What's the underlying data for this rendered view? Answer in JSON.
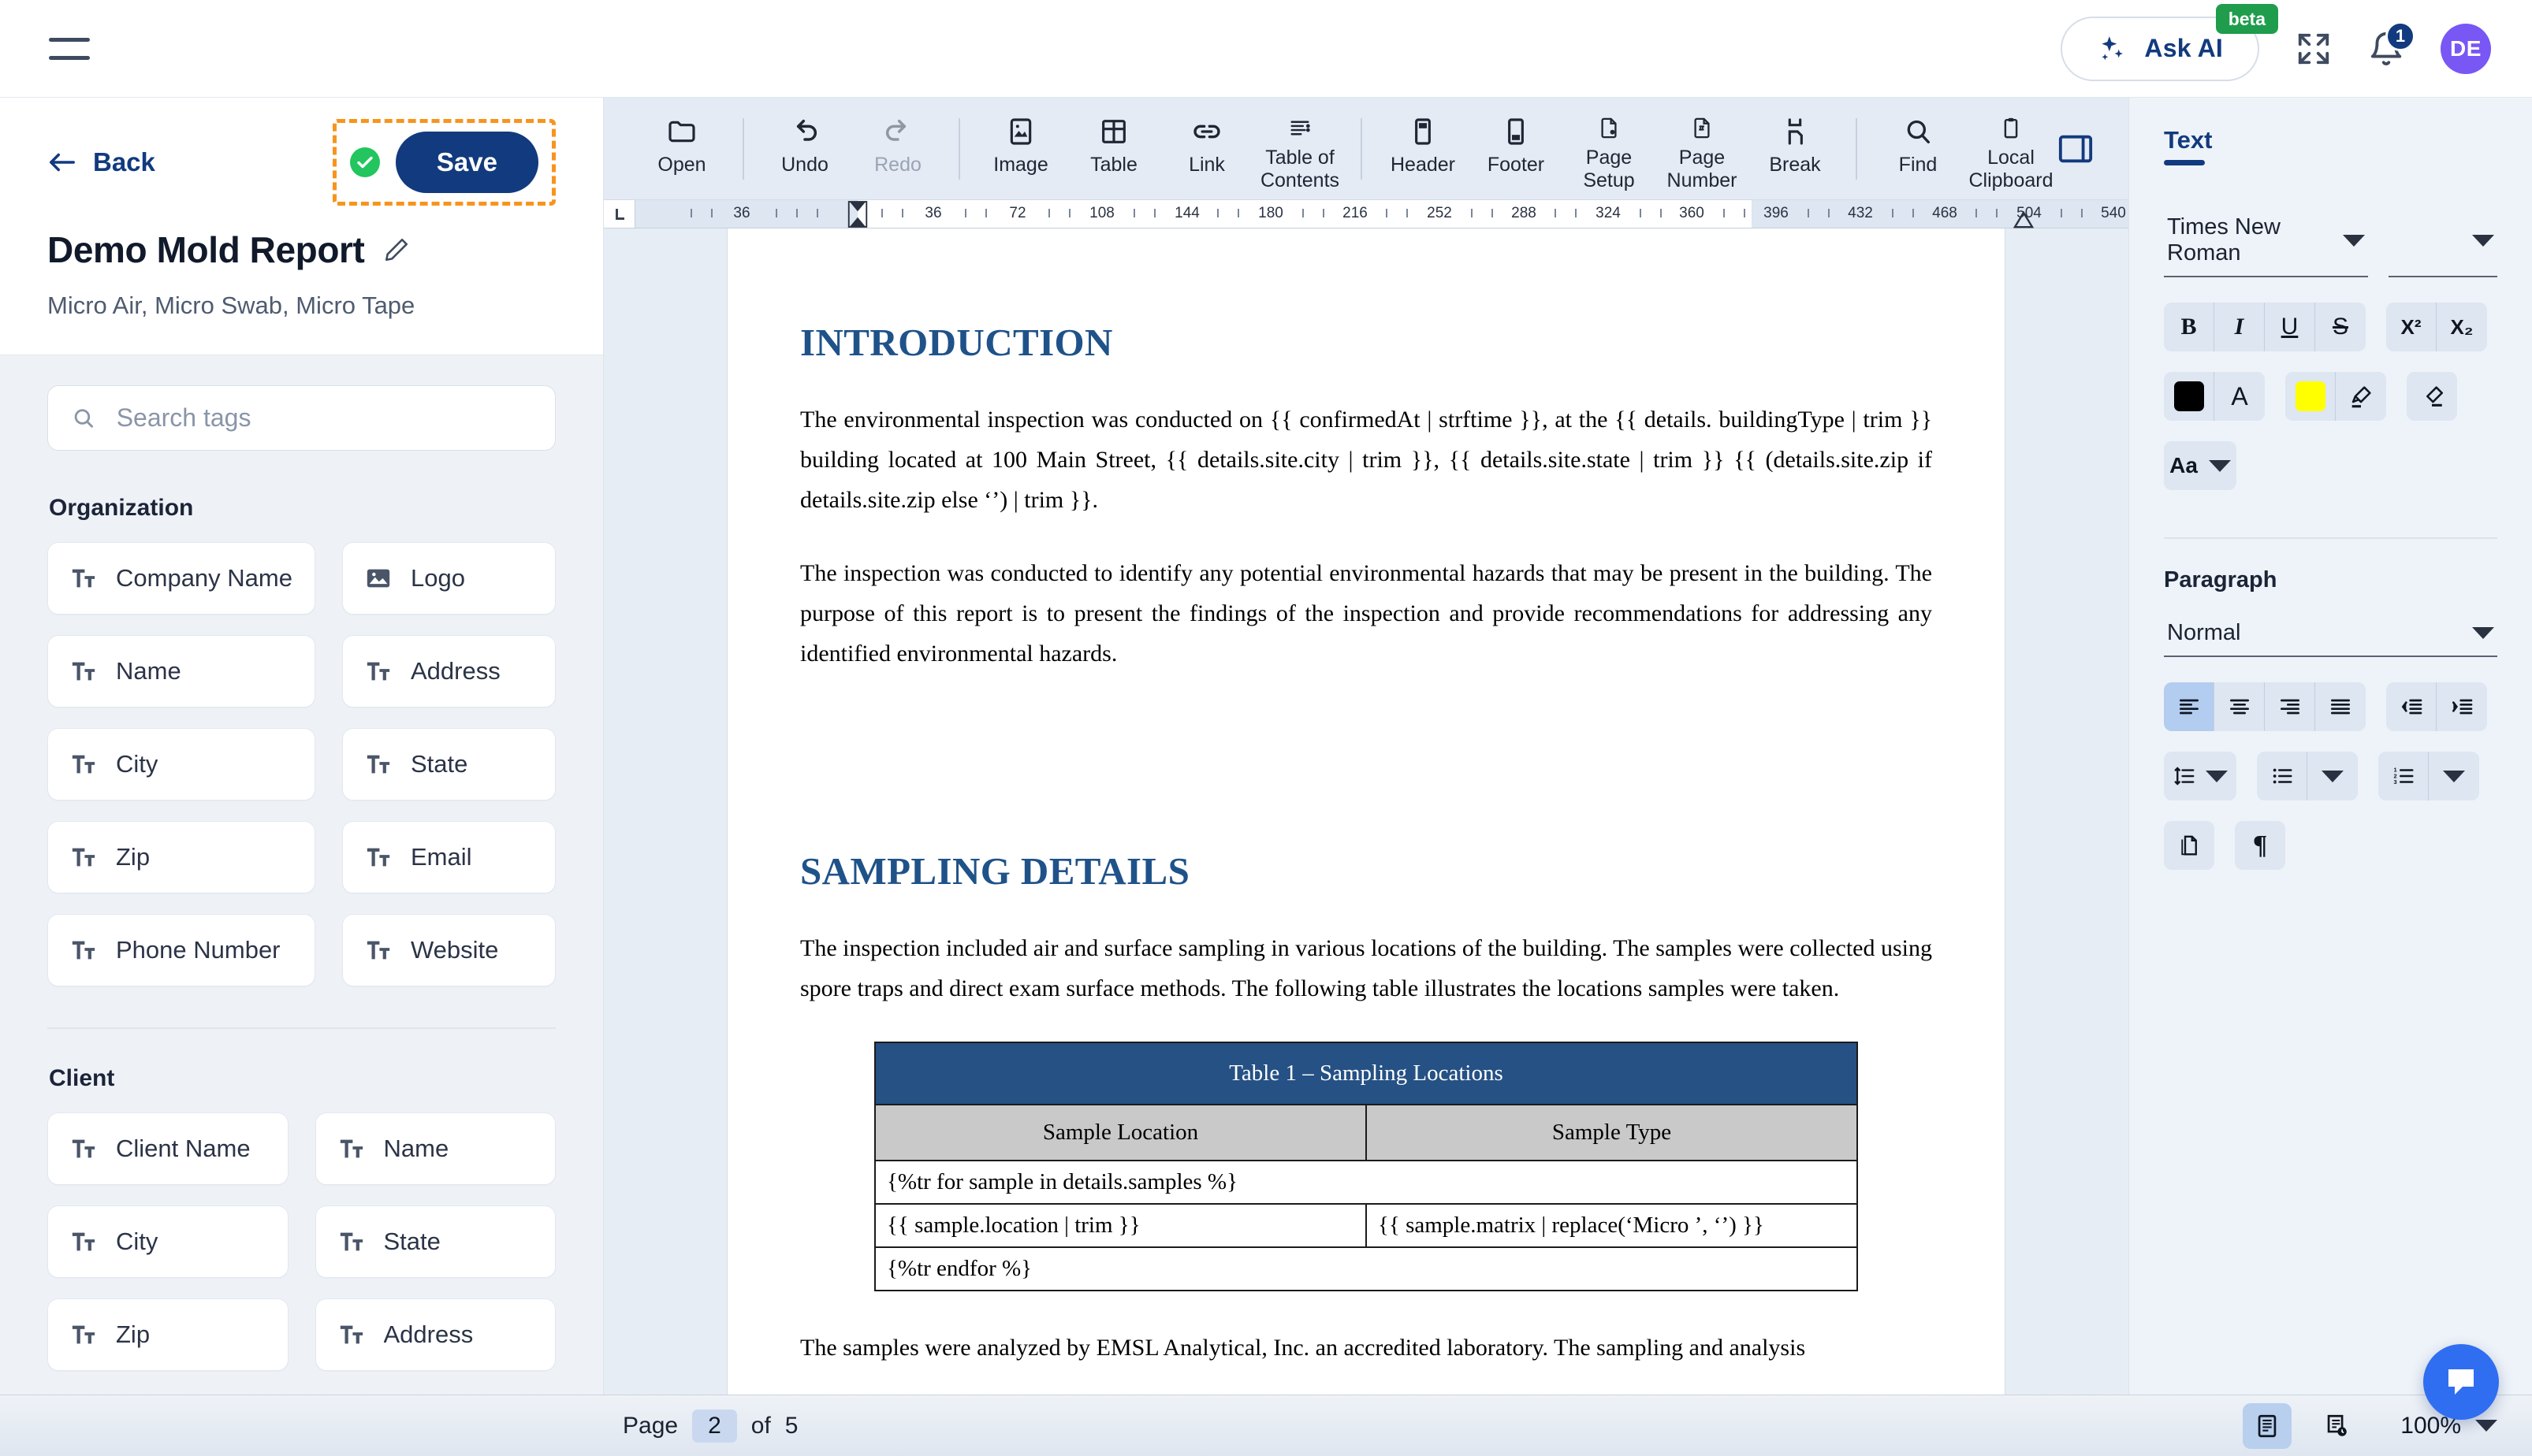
{
  "header": {
    "menu_icon": "hamburger-icon",
    "ask_ai_label": "Ask AI",
    "beta_badge": "beta",
    "fullscreen_icon": "expand-icon",
    "notification_count": "1",
    "avatar_initials": "DE"
  },
  "sidebar": {
    "back_label": "Back",
    "save_label": "Save",
    "saved_status_icon": "check-circle-icon",
    "edit_icon": "pencil-icon",
    "doc_title": "Demo Mold Report",
    "doc_subtitle": "Micro Air, Micro Swab, Micro Tape",
    "search": {
      "placeholder": "Search tags",
      "value": "",
      "icon": "search-icon"
    },
    "groups": [
      {
        "title": "Organization",
        "tags": [
          {
            "label": "Company Name",
            "icon": "text-tag-icon"
          },
          {
            "label": "Logo",
            "icon": "image-tag-icon"
          },
          {
            "label": "Name",
            "icon": "text-tag-icon"
          },
          {
            "label": "Address",
            "icon": "text-tag-icon"
          },
          {
            "label": "City",
            "icon": "text-tag-icon"
          },
          {
            "label": "State",
            "icon": "text-tag-icon"
          },
          {
            "label": "Zip",
            "icon": "text-tag-icon"
          },
          {
            "label": "Email",
            "icon": "text-tag-icon"
          },
          {
            "label": "Phone Number",
            "icon": "text-tag-icon"
          },
          {
            "label": "Website",
            "icon": "text-tag-icon"
          }
        ]
      },
      {
        "title": "Client",
        "tags": [
          {
            "label": "Client Name",
            "icon": "text-tag-icon"
          },
          {
            "label": "Name",
            "icon": "text-tag-icon"
          },
          {
            "label": "City",
            "icon": "text-tag-icon"
          },
          {
            "label": "State",
            "icon": "text-tag-icon"
          },
          {
            "label": "Zip",
            "icon": "text-tag-icon"
          },
          {
            "label": "Address",
            "icon": "text-tag-icon"
          }
        ]
      }
    ]
  },
  "toolbar": {
    "items": [
      {
        "label": "Open",
        "icon": "folder-icon",
        "disabled": false
      },
      {
        "label": "Undo",
        "icon": "undo-arrow-icon",
        "disabled": false
      },
      {
        "label": "Redo",
        "icon": "redo-arrow-icon",
        "disabled": true
      },
      {
        "label": "Image",
        "icon": "image-icon",
        "disabled": false
      },
      {
        "label": "Table",
        "icon": "table-grid-icon",
        "disabled": false
      },
      {
        "label": "Link",
        "icon": "link-chain-icon",
        "disabled": false
      },
      {
        "label": "Table of Contents",
        "icon": "list-lines-icon",
        "disabled": false
      },
      {
        "label": "Header",
        "icon": "page-header-icon",
        "disabled": false
      },
      {
        "label": "Footer",
        "icon": "page-footer-icon",
        "disabled": false
      },
      {
        "label": "Page Setup",
        "icon": "page-gear-icon",
        "disabled": false
      },
      {
        "label": "Page Number",
        "icon": "page-hash-icon",
        "disabled": false
      },
      {
        "label": "Break",
        "icon": "page-break-icon",
        "disabled": false
      },
      {
        "label": "Find",
        "icon": "search-icon",
        "disabled": false
      },
      {
        "label": "Local Clipboard",
        "icon": "clipboard-icon",
        "disabled": false
      }
    ],
    "panel_toggle_icon": "right-panel-toggle-icon"
  },
  "ruler": {
    "origin_marker": "L",
    "numbers": [
      "36",
      "36",
      "72",
      "108",
      "144",
      "180",
      "216",
      "252",
      "288",
      "324",
      "360",
      "396",
      "432",
      "468",
      "504",
      "540"
    ]
  },
  "document": {
    "sections": [
      {
        "heading": "INTRODUCTION",
        "paragraphs": [
          "The environmental inspection was conducted on {{ confirmedAt |  strftime }}, at the {{ details. buildingType | trim }} building located at 100 Main Street, {{ details.site.city | trim }}, {{ details.site.state | trim }} {{ (details.site.zip if details.site.zip else ‘’) | trim }}.",
          "The inspection was conducted to identify any potential environmental hazards that may be present in the building. The purpose of this report is to present the findings of the inspection and provide recommendations for addressing any identified environmental hazards."
        ]
      },
      {
        "heading": "SAMPLING DETAILS",
        "paragraphs": [
          "The inspection included air and surface sampling in various locations of the building. The samples were collected using spore traps and direct exam surface methods. The following table illustrates the locations samples were taken."
        ]
      }
    ],
    "table": {
      "title": "Table 1 – Sampling Locations",
      "headers": [
        "Sample Location",
        "Sample Type"
      ],
      "loop_start": "{%tr for sample in details.samples %}",
      "rows": [
        [
          "{{ sample.location | trim }}",
          "{{ sample.matrix | replace(‘Micro ’, ‘’) }}"
        ]
      ],
      "loop_end": "{%tr endfor %}"
    },
    "trailing_paragraph": "The samples were analyzed by EMSL Analytical, Inc. an accredited laboratory. The sampling and analysis"
  },
  "right_panel": {
    "tab": "Text",
    "font_family": "Times New Roman",
    "font_size": "",
    "text_buttons": [
      {
        "label": "B",
        "name": "bold-button"
      },
      {
        "label": "I",
        "name": "italic-button"
      },
      {
        "label": "U",
        "name": "underline-button"
      },
      {
        "label": "S",
        "name": "strikethrough-button"
      }
    ],
    "script_buttons": [
      {
        "label": "X²",
        "name": "superscript-button"
      },
      {
        "label": "X₂",
        "name": "subscript-button"
      }
    ],
    "text_color": "#000000",
    "highlight_color": "#ffff00",
    "case_label": "Aa",
    "paragraph_label": "Paragraph",
    "paragraph_style": "Normal",
    "align_buttons": [
      "align-left",
      "align-center",
      "align-right",
      "align-justify"
    ],
    "indent_buttons": [
      "decrease-indent",
      "increase-indent"
    ]
  },
  "status_bar": {
    "page_word": "Page",
    "page_number": "2",
    "of_word": "of",
    "total_pages": "5",
    "zoom": "100%",
    "view_icons": [
      "page-view-icon",
      "continuous-view-icon"
    ],
    "chat_icon": "chat-bubble-icon"
  },
  "colors": {
    "brand_navy": "#123a7e",
    "accent_orange": "#f7941d",
    "success_green": "#22c55e",
    "avatar_purple": "#7857f5",
    "doc_heading_blue": "#1f5289",
    "table_header_blue": "#255184",
    "chat_blue": "#2f6ef0"
  }
}
